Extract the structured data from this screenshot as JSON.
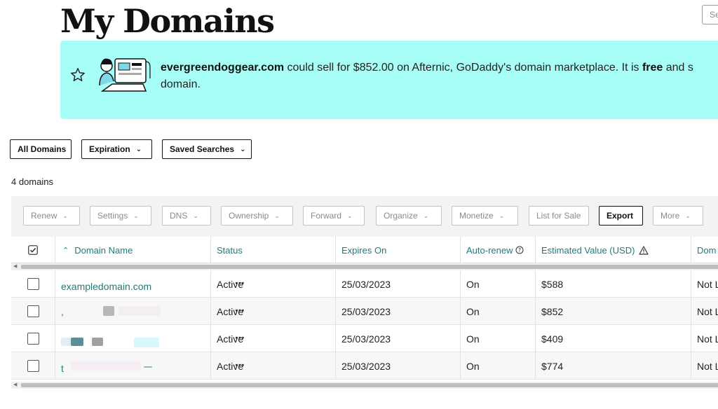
{
  "page": {
    "title": "My Domains",
    "search_placeholder": "Se"
  },
  "banner": {
    "domain": "evergreendoggear.com",
    "text_part1": " could sell for $852.00 on Afternic, GoDaddy's domain marketplace. It is ",
    "free": "free",
    "text_part2": " and s",
    "line2": "domain.",
    "bg_color": "#a6fef6"
  },
  "filters": {
    "all_domains": "All Domains",
    "expiration": "Expiration",
    "saved_searches": "Saved Searches"
  },
  "domain_count": "4 domains",
  "toolbar": {
    "renew": "Renew",
    "settings": "Settings",
    "dns": "DNS",
    "ownership": "Ownership",
    "forward": "Forward",
    "organize": "Organize",
    "monetize": "Monetize",
    "list_for_sale": "List for Sale",
    "export": "Export",
    "more": "More"
  },
  "table": {
    "columns": {
      "domain_name": "Domain Name",
      "status": "Status",
      "expires_on": "Expires On",
      "auto_renew": "Auto-renew",
      "estimated_value": "Estimated Value (USD)",
      "domain_extra": "Dom"
    },
    "rows": [
      {
        "domain": "exampledomain.com",
        "status": "Active",
        "expires": "25/03/2023",
        "auto_renew": "On",
        "value": "$588",
        "extra": "Not L"
      },
      {
        "domain": ",",
        "status": "Active",
        "expires": "25/03/2023",
        "auto_renew": "On",
        "value": "$852",
        "extra": "Not L"
      },
      {
        "domain": "",
        "status": "Active",
        "expires": "25/03/2023",
        "auto_renew": "On",
        "value": "$409",
        "extra": "Not L"
      },
      {
        "domain": "t",
        "status": "Active",
        "expires": "25/03/2023",
        "auto_renew": "On",
        "value": "$774",
        "extra": "Not L"
      }
    ]
  },
  "accent_color": "#1f7b7b"
}
